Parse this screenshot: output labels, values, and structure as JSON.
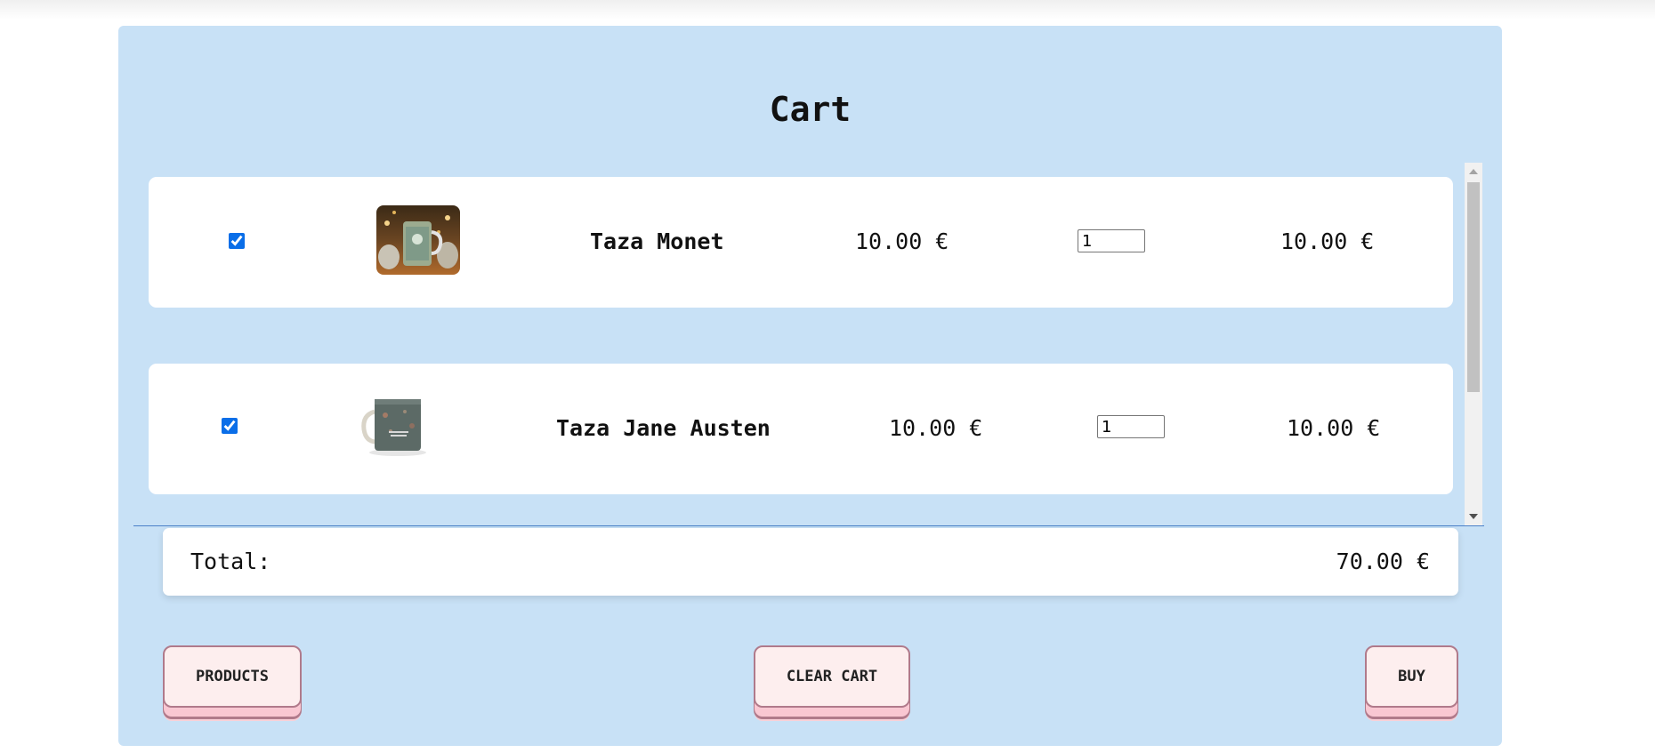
{
  "cart": {
    "title": "Cart",
    "items": [
      {
        "checked": true,
        "image_alt": "Taza Monet mug",
        "name": "Taza Monet",
        "price": "10.00 €",
        "quantity": "1",
        "subtotal": "10.00 €"
      },
      {
        "checked": true,
        "image_alt": "Taza Jane Austen mug",
        "name": "Taza Jane Austen",
        "price": "10.00 €",
        "quantity": "1",
        "subtotal": "10.00 €"
      }
    ],
    "total_label": "Total:",
    "total_value": "70.00 €"
  },
  "buttons": {
    "products": "PRODUCTS",
    "clear_cart": "CLEAR CART",
    "buy": "BUY"
  },
  "colors": {
    "panel_bg": "#c8e1f6",
    "button_bg": "#fdeeee",
    "button_border": "#b07a8b",
    "checkbox_accent": "#0a6ee8"
  }
}
